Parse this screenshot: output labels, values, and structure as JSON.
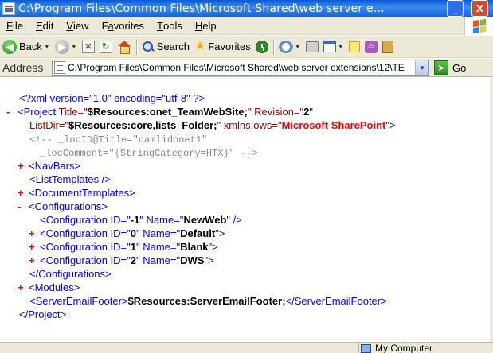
{
  "window": {
    "title": "C:\\Program Files\\Common Files\\Microsoft Shared\\web server e...",
    "minimize_label": "_",
    "close_label": "X"
  },
  "menu": [
    {
      "label": "File",
      "u": "F",
      "rest": "ile"
    },
    {
      "label": "Edit",
      "u": "E",
      "rest": "dit"
    },
    {
      "label": "View",
      "u": "V",
      "rest": "iew"
    },
    {
      "label": "Favorites",
      "pre": "F",
      "u": "a",
      "rest": "vorites"
    },
    {
      "label": "Tools",
      "u": "T",
      "rest": "ools"
    },
    {
      "label": "Help",
      "u": "H",
      "rest": "elp"
    }
  ],
  "toolbar": {
    "back_label": "Back",
    "search_label": "Search",
    "favorites_label": "Favorites"
  },
  "address": {
    "label": "Address",
    "value": "C:\\Program Files\\Common Files\\Microsoft Shared\\web server extensions\\12\\TE",
    "go_label": "Go"
  },
  "xml": {
    "pi": "<?xml version=\"1.0\" encoding=\"utf-8\" ?>",
    "project_open_1_tag": "<Project",
    "project_attr_title": "Title=\"",
    "project_val_title": "$Resources:onet_TeamWebSite;",
    "project_attr_rev": "\" Revision=\"",
    "project_val_rev": "2",
    "project_attr_rev_end": "\"",
    "listdir_attr": "ListDir=\"",
    "listdir_val": "$Resources:core,lists_Folder;",
    "listdir_end": "\"",
    "xmlns_attr": "xmlns:ows=\"",
    "xmlns_val": "Microsoft SharePoint",
    "xmlns_end": "\">",
    "comment_1": "<!--  _locID@Title=\"camlidonet1\"",
    "comment_2": "_locComment=\"{StringCategory=HTX}\"   -->",
    "navbars": "<NavBars>",
    "listtemplates": "<ListTemplates />",
    "doctemplates": "<DocumentTemplates>",
    "configurations_open": "<Configurations>",
    "config_tag": "<Configuration ID=\"",
    "config_name": "\" Name=\"",
    "configs": [
      {
        "id": "-1",
        "name": "NewWeb",
        "end": "\" />"
      },
      {
        "id": "0",
        "name": "Default",
        "end": "\">"
      },
      {
        "id": "1",
        "name": "Blank",
        "end": "\">"
      },
      {
        "id": "2",
        "name": "DWS",
        "end": "\">"
      }
    ],
    "configurations_close": "</Configurations>",
    "modules": "<Modules>",
    "sef_open": "<ServerEmailFooter>",
    "sef_val": "$Resources:ServerEmailFooter;",
    "sef_close": "</ServerEmailFooter>",
    "project_close": "</Project>",
    "toggle_minus": "-",
    "toggle_plus": "+"
  },
  "status": {
    "zone": "My Computer"
  },
  "colors": {
    "title_bar": "#0a5ad7",
    "chrome": "#ece9d8",
    "markup_blue": "#0000ff",
    "attr_red": "#990000",
    "toggle_red": "#e0001a"
  }
}
